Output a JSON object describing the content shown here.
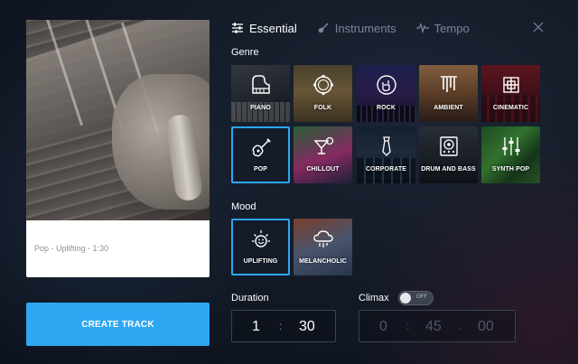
{
  "tabs": [
    {
      "label": "Essential",
      "icon": "sliders-icon",
      "active": true
    },
    {
      "label": "Instruments",
      "icon": "guitar-icon",
      "active": false
    },
    {
      "label": "Tempo",
      "icon": "pulse-icon",
      "active": false
    }
  ],
  "preview": {
    "caption": "Pop - Uplifting - 1:30"
  },
  "create_button": {
    "label": "CREATE TRACK"
  },
  "genre": {
    "label": "Genre",
    "items": [
      {
        "label": "PIANO",
        "icon": "piano-icon",
        "selected": false
      },
      {
        "label": "FOLK",
        "icon": "tambourine-icon",
        "selected": false
      },
      {
        "label": "ROCK",
        "icon": "rock-hand-icon",
        "selected": false
      },
      {
        "label": "AMBIENT",
        "icon": "chimes-icon",
        "selected": false
      },
      {
        "label": "CINEMATIC",
        "icon": "celtic-knot-icon",
        "selected": false
      },
      {
        "label": "POP",
        "icon": "guitar-icon",
        "selected": true
      },
      {
        "label": "CHILLOUT",
        "icon": "cocktail-icon",
        "selected": false
      },
      {
        "label": "CORPORATE",
        "icon": "tie-icon",
        "selected": false
      },
      {
        "label": "DRUM AND BASS",
        "icon": "speaker-icon",
        "selected": false
      },
      {
        "label": "SYNTH POP",
        "icon": "mixer-icon",
        "selected": false
      }
    ]
  },
  "mood": {
    "label": "Mood",
    "items": [
      {
        "label": "UPLIFTING",
        "icon": "sun-icon",
        "selected": true
      },
      {
        "label": "MELANCHOLIC",
        "icon": "rain-cloud-icon",
        "selected": false
      }
    ]
  },
  "duration": {
    "label": "Duration",
    "minutes": "1",
    "separator": ":",
    "seconds": "30"
  },
  "climax": {
    "label": "Climax",
    "toggle_state": "OFF",
    "enabled": false,
    "minutes": "0",
    "separator1": ":",
    "seconds": "45",
    "separator2": ".",
    "fraction": "00"
  },
  "colors": {
    "accent": "#2da7f2",
    "background": "#121925",
    "tab_inactive": "#7c8594"
  }
}
